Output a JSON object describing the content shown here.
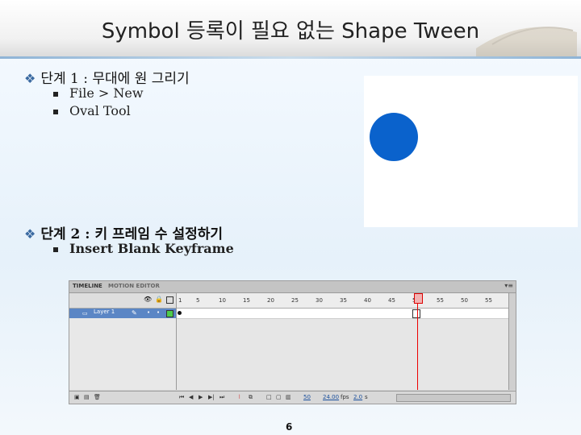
{
  "title": "Symbol 등록이 필요 없는 Shape Tween",
  "step1": {
    "heading": "단계 1 : 무대에 원 그리기",
    "items": [
      "File > New",
      "Oval Tool"
    ]
  },
  "step2": {
    "heading": "단계 2 : 키 프레임 수 설정하기",
    "items": [
      "Insert Blank Keyframe"
    ]
  },
  "timeline": {
    "tabs": [
      "TIMELINE",
      "MOTION EDITOR"
    ],
    "ruler_ticks": [
      "1",
      "5",
      "10",
      "15",
      "20",
      "25",
      "30",
      "35",
      "40",
      "45",
      "50",
      "55",
      "50",
      "55"
    ],
    "layer_name": "Layer 1",
    "status": {
      "current_frame": "50",
      "fps": "24.00",
      "fps_unit": "fps",
      "time": "2.0",
      "time_unit": "s"
    }
  },
  "page_number": "6",
  "colors": {
    "circle": "#0a62cc",
    "playhead": "#e00000",
    "accent": "#3b6aa1"
  }
}
